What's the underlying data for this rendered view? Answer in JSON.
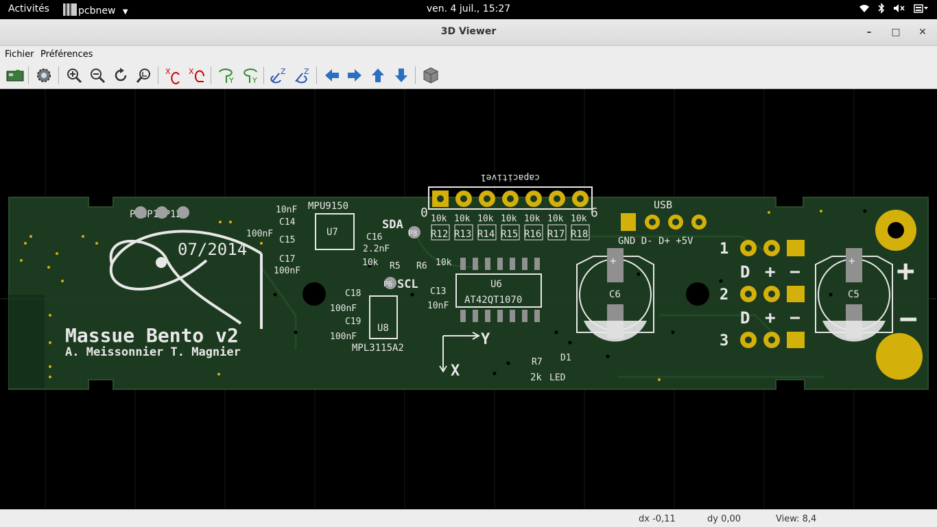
{
  "topbar": {
    "activities": "Activités",
    "app_name": "pcbnew",
    "clock": "ven.  4 juil., 15:27"
  },
  "window": {
    "title": "3D Viewer"
  },
  "menu": {
    "items": [
      "Fichier",
      "Préférences"
    ]
  },
  "toolbar": {
    "icons": [
      "reload-board-icon",
      "settings-icon",
      "zoom-in-icon",
      "zoom-out-icon",
      "redraw-icon",
      "zoom-fit-icon",
      "rotate-x-cw-icon",
      "rotate-x-ccw-icon",
      "rotate-y-cw-icon",
      "rotate-y-ccw-icon",
      "rotate-z-cw-icon",
      "rotate-z-ccw-icon",
      "pan-left-icon",
      "pan-right-icon",
      "pan-up-icon",
      "pan-down-icon",
      "ortho-view-icon"
    ]
  },
  "board": {
    "colors": {
      "pcb": "#1c3a1f",
      "copper": "#d4b00a",
      "silk": "#e8e8e8",
      "background": "#000000"
    },
    "title": "Massue Bento v2",
    "authors": "A. Meissonnier   T. Magnier",
    "date": "07/2014",
    "capacitive_header": "capacitive1",
    "header_pin_first": "0",
    "header_pin_last": "6",
    "resistors_top": [
      "R12",
      "R13",
      "R14",
      "R15",
      "R16",
      "R17",
      "R18"
    ],
    "resistor_value": "10k",
    "usb_label": "USB",
    "usb_pins": "GND D- D+ +5V",
    "pads_top_left": "P14P13P12",
    "mpu_label": "MPU9150",
    "u7": "U7",
    "c14": "C14",
    "c15": "C15",
    "c17": "C17",
    "c16": "C16",
    "cap_10nf": "10nF",
    "cap_100nf": "100nF",
    "cap_22nf": "2.2nF",
    "sda": "SDA",
    "scl": "SCL",
    "p8": "P8",
    "p6": "P6",
    "r5": "R5",
    "r6": "R6",
    "u6": "U6",
    "u6_part": "AT42QT1070",
    "c13": "C13",
    "c18": "C18",
    "c19": "C19",
    "u8": "U8",
    "u8_part": "MPL3115A2",
    "r7": "R7",
    "r7_value": "2k",
    "d1": "D1",
    "d1_value": "LED",
    "c6": "C6",
    "c5": "C5",
    "axis_x": "X",
    "axis_y": "Y",
    "conn_numbers": [
      "1",
      "2",
      "3"
    ],
    "d_letter": "D",
    "plus": "+",
    "minus": "−"
  },
  "status": {
    "dx": "dx -0,11",
    "dy": "dy 0,00",
    "view": "View: 8,4"
  }
}
